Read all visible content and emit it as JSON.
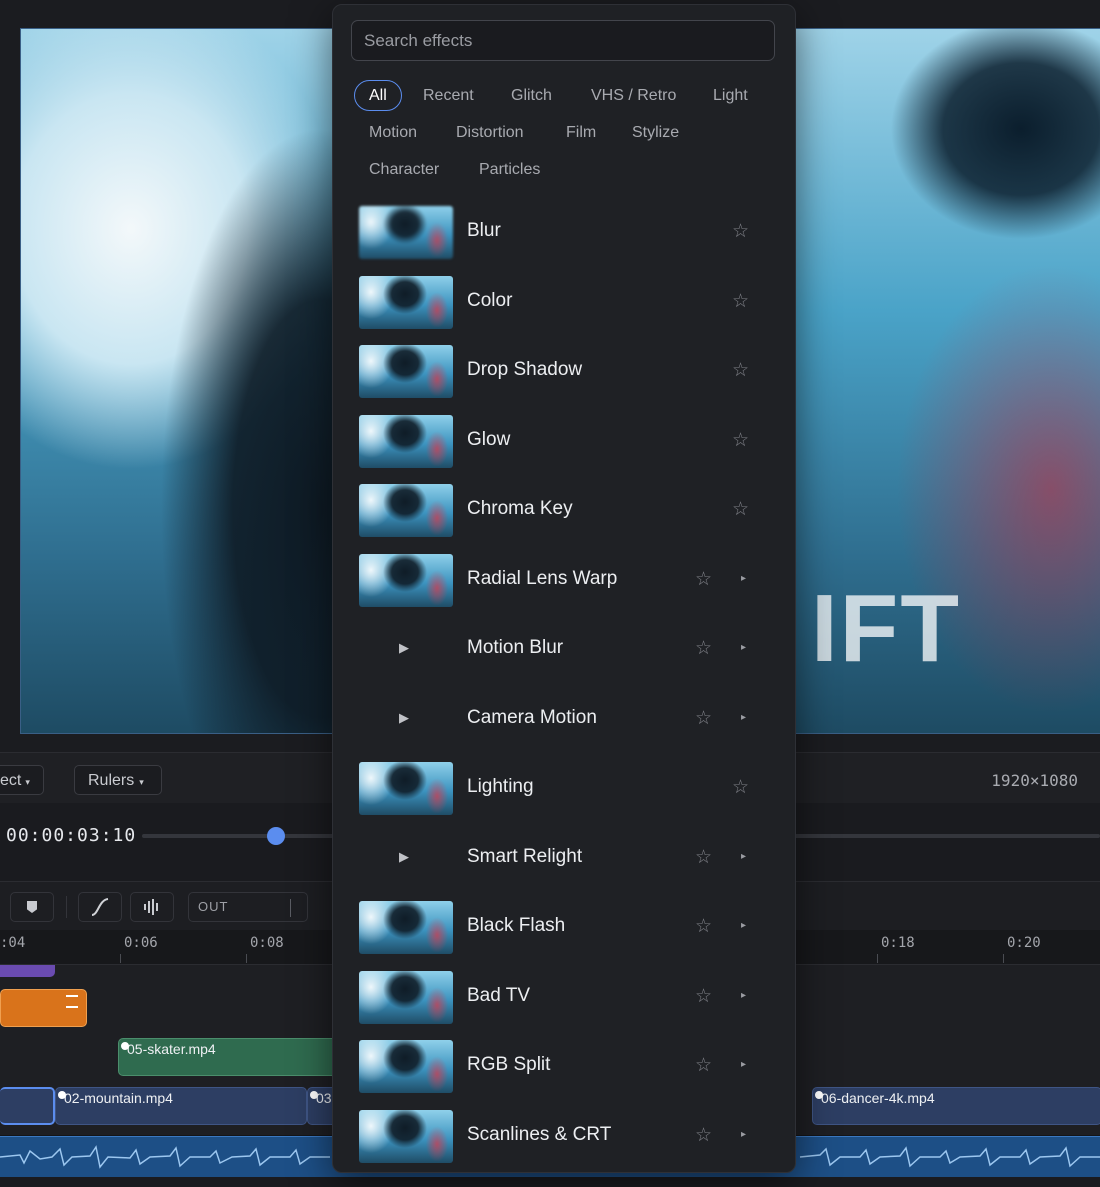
{
  "search": {
    "placeholder": "Search effects"
  },
  "categories": [
    {
      "label": "All",
      "active": true
    },
    {
      "label": "Recent"
    },
    {
      "label": "Glitch"
    },
    {
      "label": "VHS / Retro"
    },
    {
      "label": "Light"
    },
    {
      "label": "Motion"
    },
    {
      "label": "Distortion"
    },
    {
      "label": "Film"
    },
    {
      "label": "Stylize"
    },
    {
      "label": "Character"
    },
    {
      "label": "Particles"
    }
  ],
  "effects": [
    {
      "label": "Blur",
      "thumb": true,
      "submenu": false
    },
    {
      "label": "Color",
      "thumb": true,
      "submenu": false
    },
    {
      "label": "Drop Shadow",
      "thumb": true,
      "submenu": false
    },
    {
      "label": "Glow",
      "thumb": true,
      "submenu": false
    },
    {
      "label": "Chroma Key",
      "thumb": true,
      "submenu": false
    },
    {
      "label": "Radial Lens Warp",
      "thumb": true,
      "submenu": true
    },
    {
      "label": "Motion Blur",
      "thumb": false,
      "submenu": true
    },
    {
      "label": "Camera Motion",
      "thumb": false,
      "submenu": true
    },
    {
      "label": "Lighting",
      "thumb": true,
      "submenu": false
    },
    {
      "label": "Smart Relight",
      "thumb": false,
      "submenu": true
    },
    {
      "label": "Black Flash",
      "thumb": true,
      "submenu": true
    },
    {
      "label": "Bad TV",
      "thumb": true,
      "submenu": true
    },
    {
      "label": "RGB Split",
      "thumb": true,
      "submenu": true
    },
    {
      "label": "Scanlines & CRT",
      "thumb": true,
      "submenu": true
    }
  ],
  "icons": {
    "star": "☆",
    "submenu_arrow": "▸",
    "expand_arrow": "▶"
  },
  "preview": {
    "overlay_text": "IFT"
  },
  "toolbar": {
    "select_label": "ect",
    "rulers_label": "Rulers",
    "resolution": "1920×1080"
  },
  "transport": {
    "timecode": "00:00:03:10",
    "playhead_fraction": 0.14
  },
  "tools": {
    "out_label": "OUT"
  },
  "ruler_ticks": [
    ":04",
    "0:06",
    "0:08",
    "0:18",
    "0:20"
  ],
  "clips": {
    "skater": "05-skater.mp4",
    "mountain": "02-mountain.mp4",
    "partial": "03",
    "dancer": "06-dancer-4k.mp4"
  },
  "colors": {
    "accent": "#5b8def",
    "panel_bg": "#1f2125",
    "text_clip_orange": "#d9731b",
    "purple_clip": "#6a4bb0",
    "green_clip": "#2f6b4f",
    "video_clip": "#2d3e63",
    "audio_clip": "#1d4f86"
  }
}
